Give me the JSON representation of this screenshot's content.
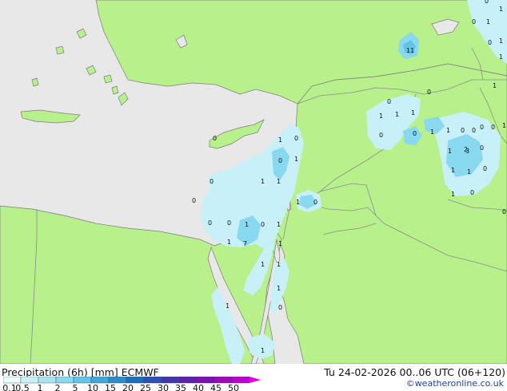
{
  "title": {
    "left": "Precipitation (6h) [mm] ECMWF",
    "right": "Tu 24-02-2026 00..06 UTC (06+120)",
    "credit": "©weatheronline.co.uk"
  },
  "legend": {
    "ticks": [
      "0.1",
      "0.5",
      "1",
      "2",
      "5",
      "10",
      "15",
      "20",
      "25",
      "30",
      "35",
      "40",
      "45",
      "50"
    ],
    "colors": [
      "#e8fcfc",
      "#c8f0f8",
      "#a8e4f4",
      "#88d8f0",
      "#60c4e8",
      "#3ca8dc",
      "#2c8cd0",
      "#1c70c4",
      "#2c50b8",
      "#4038b0",
      "#6020b0",
      "#8010b8",
      "#a008c0",
      "#c000d0",
      "#e000e0"
    ]
  },
  "colors": {
    "land": "#b8f08c",
    "sea": "#e8e8e8",
    "border": "#8c8c8c",
    "coast": "#7c7c7c"
  },
  "map_numbers": [
    "0",
    "0",
    "1",
    "1",
    "1",
    "0",
    "1",
    "1",
    "1",
    "11",
    "0",
    "1",
    "1",
    "0",
    "1",
    "0",
    "0",
    "1",
    "1",
    "0",
    "0",
    "0",
    "0",
    "1",
    "2",
    "0",
    "1",
    "1",
    "0",
    "1",
    "0",
    "0",
    "0",
    "0",
    "1",
    "0",
    "1",
    "7",
    "0",
    "0",
    "1",
    "0",
    "1",
    "1",
    "0",
    "1",
    "1",
    "0",
    "0",
    "1",
    "1",
    "3",
    "1",
    "1",
    "1",
    "1",
    "0",
    "1"
  ]
}
